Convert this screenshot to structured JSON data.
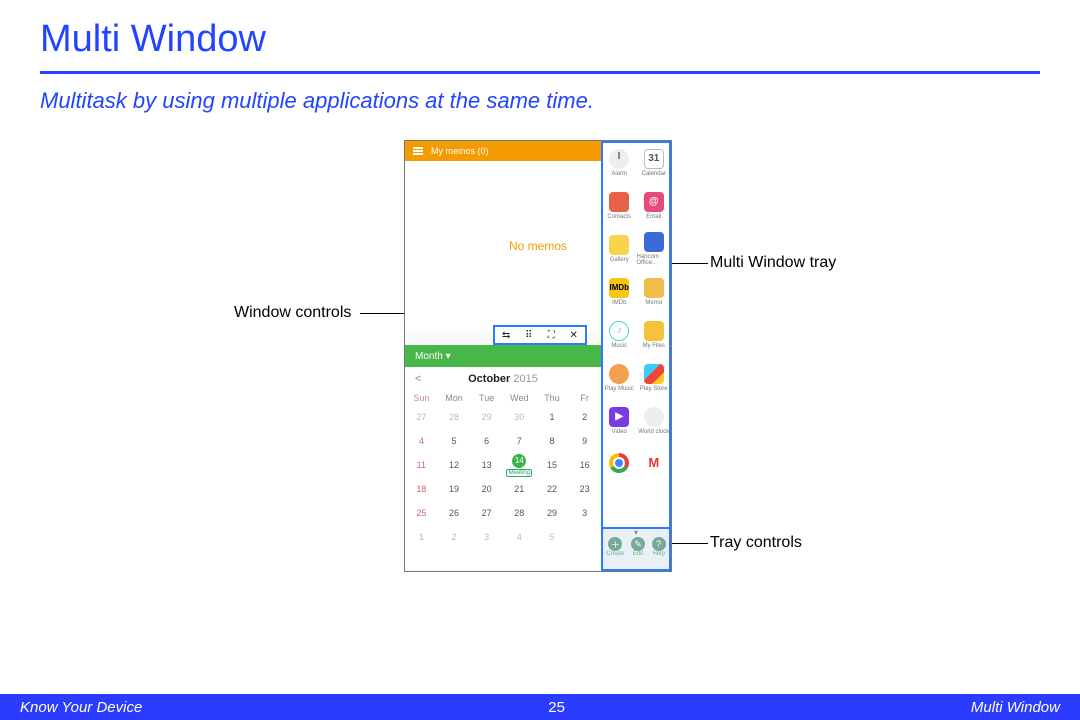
{
  "header": {
    "title": "Multi Window",
    "subtitle": "Multitask by using multiple applications at the same time."
  },
  "callouts": {
    "window_controls": "Window controls",
    "tray": "Multi Window tray",
    "tray_controls": "Tray controls"
  },
  "memos": {
    "bar": "My memos (0)",
    "empty": "No memos"
  },
  "calendar": {
    "month_label": "Month  ▾",
    "title_strong": "October",
    "title_year": "2015",
    "dow": [
      "Sun",
      "Mon",
      "Tue",
      "Wed",
      "Thu",
      "Fr"
    ],
    "rows": [
      [
        "27",
        "28",
        "29",
        "30",
        "1",
        "2"
      ],
      [
        "4",
        "5",
        "6",
        "7",
        "8",
        "9"
      ],
      [
        "11",
        "12",
        "13",
        "14",
        "15",
        "16"
      ],
      [
        "18",
        "19",
        "20",
        "21",
        "22",
        "23"
      ],
      [
        "25",
        "26",
        "27",
        "28",
        "29",
        "3"
      ],
      [
        "1",
        "2",
        "3",
        "4",
        "5",
        ""
      ]
    ],
    "event": "Meeting"
  },
  "tray": {
    "apps": [
      {
        "n": "Alarm",
        "c": "alarm",
        "t": ""
      },
      {
        "n": "Calendar",
        "c": "calendar",
        "t": "31"
      },
      {
        "n": "Contacts",
        "c": "contacts",
        "t": ""
      },
      {
        "n": "Email",
        "c": "email",
        "t": "@"
      },
      {
        "n": "Gallery",
        "c": "gallery",
        "t": ""
      },
      {
        "n": "Hancom Office..",
        "c": "hancom",
        "t": ""
      },
      {
        "n": "IMDb",
        "c": "imdb",
        "t": "IMDb"
      },
      {
        "n": "Memo",
        "c": "memo",
        "t": ""
      },
      {
        "n": "Music",
        "c": "music",
        "t": "♪"
      },
      {
        "n": "My Files",
        "c": "files",
        "t": ""
      },
      {
        "n": "Play Music",
        "c": "pmusic",
        "t": ""
      },
      {
        "n": "Play Store",
        "c": "pstore",
        "t": ""
      },
      {
        "n": "Video",
        "c": "video",
        "t": "▶"
      },
      {
        "n": "World clock",
        "c": "wclock",
        "t": ""
      },
      {
        "n": "",
        "c": "chrome",
        "t": ""
      },
      {
        "n": "",
        "c": "gmail",
        "t": "M"
      }
    ],
    "controls": {
      "create": "Create",
      "edit": "Edit",
      "help": "Help"
    }
  },
  "footer": {
    "left": "Know Your Device",
    "page": "25",
    "right": "Multi Window"
  }
}
